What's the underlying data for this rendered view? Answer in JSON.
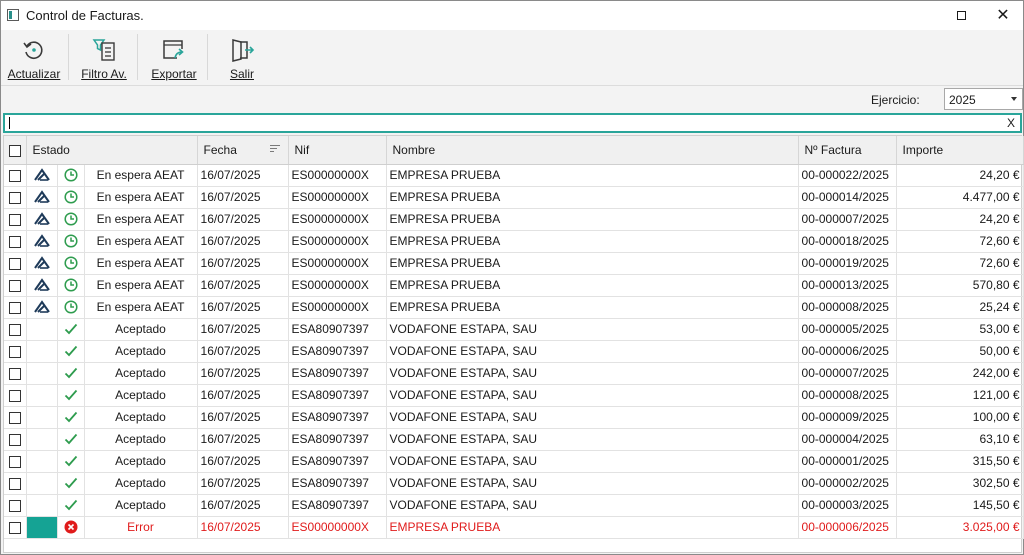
{
  "window": {
    "title": "Control de Facturas."
  },
  "toolbar": {
    "actualizar": "Actualizar",
    "filtro": "Filtro Av.",
    "exportar": "Exportar",
    "salir": "Salir"
  },
  "filter": {
    "ejercicio_label": "Ejercicio:",
    "ejercicio_value": "2025"
  },
  "search": {
    "value": "",
    "clear_label": "X"
  },
  "colors": {
    "accent": "#2aa59a",
    "ok": "#2e9c4e",
    "error": "#e01b1b",
    "teal_cell": "#15a394"
  },
  "table": {
    "headers": {
      "estado": "Estado",
      "fecha": "Fecha",
      "nif": "Nif",
      "nombre": "Nombre",
      "factura": "Nº Factura",
      "importe": "Importe"
    },
    "rows": [
      {
        "type_icon": "aeat-logo-icon",
        "status_icon": "clock-icon",
        "estado": "En espera AEAT",
        "fecha": "16/07/2025",
        "nif": "ES00000000X",
        "nombre": "EMPRESA PRUEBA",
        "factura": "00-000022/2025",
        "importe": "24,20 €"
      },
      {
        "type_icon": "aeat-logo-icon",
        "status_icon": "clock-icon",
        "estado": "En espera AEAT",
        "fecha": "16/07/2025",
        "nif": "ES00000000X",
        "nombre": "EMPRESA PRUEBA",
        "factura": "00-000014/2025",
        "importe": "4.477,00 €"
      },
      {
        "type_icon": "aeat-logo-icon",
        "status_icon": "clock-icon",
        "estado": "En espera AEAT",
        "fecha": "16/07/2025",
        "nif": "ES00000000X",
        "nombre": "EMPRESA PRUEBA",
        "factura": "00-000007/2025",
        "importe": "24,20 €"
      },
      {
        "type_icon": "aeat-logo-icon",
        "status_icon": "clock-icon",
        "estado": "En espera AEAT",
        "fecha": "16/07/2025",
        "nif": "ES00000000X",
        "nombre": "EMPRESA PRUEBA",
        "factura": "00-000018/2025",
        "importe": "72,60 €"
      },
      {
        "type_icon": "aeat-logo-icon",
        "status_icon": "clock-icon",
        "estado": "En espera AEAT",
        "fecha": "16/07/2025",
        "nif": "ES00000000X",
        "nombre": "EMPRESA PRUEBA",
        "factura": "00-000019/2025",
        "importe": "72,60 €"
      },
      {
        "type_icon": "aeat-logo-icon",
        "status_icon": "clock-icon",
        "estado": "En espera AEAT",
        "fecha": "16/07/2025",
        "nif": "ES00000000X",
        "nombre": "EMPRESA PRUEBA",
        "factura": "00-000013/2025",
        "importe": "570,80 €"
      },
      {
        "type_icon": "aeat-logo-icon",
        "status_icon": "clock-icon",
        "estado": "En espera AEAT",
        "fecha": "16/07/2025",
        "nif": "ES00000000X",
        "nombre": "EMPRESA PRUEBA",
        "factura": "00-000008/2025",
        "importe": "25,24 €"
      },
      {
        "type_icon": "",
        "status_icon": "check-icon",
        "estado": "Aceptado",
        "fecha": "16/07/2025",
        "nif": "ESA80907397",
        "nombre": "VODAFONE ESTAPA, SAU",
        "factura": "00-000005/2025",
        "importe": "53,00 €"
      },
      {
        "type_icon": "",
        "status_icon": "check-icon",
        "estado": "Aceptado",
        "fecha": "16/07/2025",
        "nif": "ESA80907397",
        "nombre": "VODAFONE ESTAPA, SAU",
        "factura": "00-000006/2025",
        "importe": "50,00 €"
      },
      {
        "type_icon": "",
        "status_icon": "check-icon",
        "estado": "Aceptado",
        "fecha": "16/07/2025",
        "nif": "ESA80907397",
        "nombre": "VODAFONE ESTAPA, SAU",
        "factura": "00-000007/2025",
        "importe": "242,00 €"
      },
      {
        "type_icon": "",
        "status_icon": "check-icon",
        "estado": "Aceptado",
        "fecha": "16/07/2025",
        "nif": "ESA80907397",
        "nombre": "VODAFONE ESTAPA, SAU",
        "factura": "00-000008/2025",
        "importe": "121,00 €"
      },
      {
        "type_icon": "",
        "status_icon": "check-icon",
        "estado": "Aceptado",
        "fecha": "16/07/2025",
        "nif": "ESA80907397",
        "nombre": "VODAFONE ESTAPA, SAU",
        "factura": "00-000009/2025",
        "importe": "100,00 €"
      },
      {
        "type_icon": "",
        "status_icon": "check-icon",
        "estado": "Aceptado",
        "fecha": "16/07/2025",
        "nif": "ESA80907397",
        "nombre": "VODAFONE ESTAPA, SAU",
        "factura": "00-000004/2025",
        "importe": "63,10 €"
      },
      {
        "type_icon": "",
        "status_icon": "check-icon",
        "estado": "Aceptado",
        "fecha": "16/07/2025",
        "nif": "ESA80907397",
        "nombre": "VODAFONE ESTAPA, SAU",
        "factura": "00-000001/2025",
        "importe": "315,50 €"
      },
      {
        "type_icon": "",
        "status_icon": "check-icon",
        "estado": "Aceptado",
        "fecha": "16/07/2025",
        "nif": "ESA80907397",
        "nombre": "VODAFONE ESTAPA, SAU",
        "factura": "00-000002/2025",
        "importe": "302,50 €"
      },
      {
        "type_icon": "",
        "status_icon": "check-icon",
        "estado": "Aceptado",
        "fecha": "16/07/2025",
        "nif": "ESA80907397",
        "nombre": "VODAFONE ESTAPA, SAU",
        "factura": "00-000003/2025",
        "importe": "145,50 €"
      },
      {
        "type_icon": "teal-cell",
        "status_icon": "error-icon",
        "estado": "Error",
        "fecha": "16/07/2025",
        "nif": "ES00000000X",
        "nombre": "EMPRESA PRUEBA",
        "factura": "00-000006/2025",
        "importe": "3.025,00 €",
        "is_error": true
      }
    ]
  }
}
